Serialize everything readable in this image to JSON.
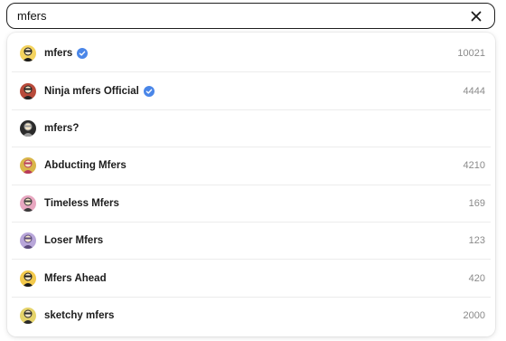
{
  "search": {
    "value": "mfers"
  },
  "results": [
    {
      "name": "mfers",
      "verified": true,
      "count": "10021",
      "avatar_icon": "mfers-avatar-icon",
      "avatar_colors": [
        "#f4d35e",
        "#1a1a1a"
      ]
    },
    {
      "name": "Ninja mfers Official",
      "verified": true,
      "count": "4444",
      "avatar_icon": "ninja-mfers-avatar-icon",
      "avatar_colors": [
        "#b84a3a",
        "#222222"
      ]
    },
    {
      "name": "mfers?",
      "verified": false,
      "count": "",
      "avatar_icon": "mfers-question-avatar-icon",
      "avatar_colors": [
        "#2b2b2b",
        "#9a9a9a"
      ]
    },
    {
      "name": "Abducting Mfers",
      "verified": false,
      "count": "4210",
      "avatar_icon": "abducting-mfers-avatar-icon",
      "avatar_colors": [
        "#d9b64a",
        "#b83a5a"
      ]
    },
    {
      "name": "Timeless Mfers",
      "verified": false,
      "count": "169",
      "avatar_icon": "timeless-mfers-avatar-icon",
      "avatar_colors": [
        "#e8a7c0",
        "#3a3a3a"
      ]
    },
    {
      "name": "Loser Mfers",
      "verified": false,
      "count": "123",
      "avatar_icon": "loser-mfers-avatar-icon",
      "avatar_colors": [
        "#b8a6d9",
        "#5a4a7a"
      ]
    },
    {
      "name": "Mfers Ahead",
      "verified": false,
      "count": "420",
      "avatar_icon": "mfers-ahead-avatar-icon",
      "avatar_colors": [
        "#f2c94c",
        "#1a1a1a"
      ]
    },
    {
      "name": "sketchy mfers",
      "verified": false,
      "count": "2000",
      "avatar_icon": "sketchy-mfers-avatar-icon",
      "avatar_colors": [
        "#e5d36a",
        "#2a2a2a"
      ]
    }
  ],
  "colors": {
    "verified_badge": "#4a86e8",
    "border": "#1f1f1f",
    "count_text": "#8a8a8a"
  }
}
